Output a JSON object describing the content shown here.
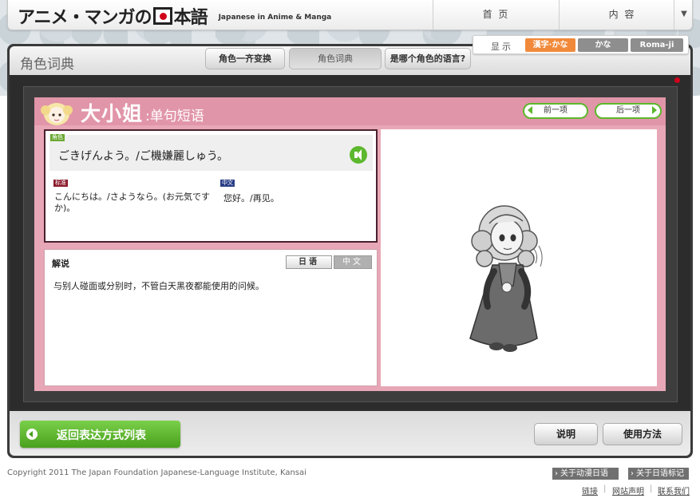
{
  "header": {
    "logo_main_left": "アニメ・マンガの",
    "logo_main_right": "本語",
    "logo_subtitle": "Japanese in Anime & Manga",
    "nav": {
      "home": "首 页",
      "contents": "内 容",
      "dropdown_icon": "▼"
    }
  },
  "display": {
    "label": "显示",
    "options": [
      "漢字·かな",
      "かな",
      "Roma-ji"
    ],
    "selected": "漢字·かな",
    "selected_color": "#f08a3a"
  },
  "section": {
    "title": "角色词典",
    "tabs": [
      "角色一齐变换",
      "角色词典",
      "是哪个角色的语言?"
    ],
    "active_tab": "角色词典"
  },
  "entry": {
    "character_name": "大小姐",
    "subtitle": ":单句短语",
    "prev_label": "前一项",
    "next_label": "后一项",
    "role_tag": "角色",
    "phrase": "ごきげんよう。/ご機嫌麗しゅう。",
    "standard_tag": "标准",
    "standard_text": "こんにちは。/さようなら。(お元気ですか)。",
    "chinese_tag": "中文",
    "chinese_text": "您好。/再见。"
  },
  "explanation": {
    "title": "解说",
    "lang_ja": "日语",
    "lang_zh": "中文",
    "text": "与别人碰面或分别时，不管白天黑夜都能使用的问候。"
  },
  "bottom": {
    "back_label": "返回表达方式列表",
    "help_label": "说明",
    "usage_label": "使用方法"
  },
  "footer": {
    "copyright": "Copyright 2011 The Japan Foundation Japanese-Language Institute, Kansai",
    "about_anime": "关于动漫日语",
    "about_mark": "关于日语标记",
    "links": [
      "链接",
      "网站声明",
      "联系我们"
    ],
    "separator": "|"
  },
  "colors": {
    "accent_green": "#5cb82d",
    "pink_panel": "#e8a7b6",
    "brand_red": "#d0021b"
  }
}
